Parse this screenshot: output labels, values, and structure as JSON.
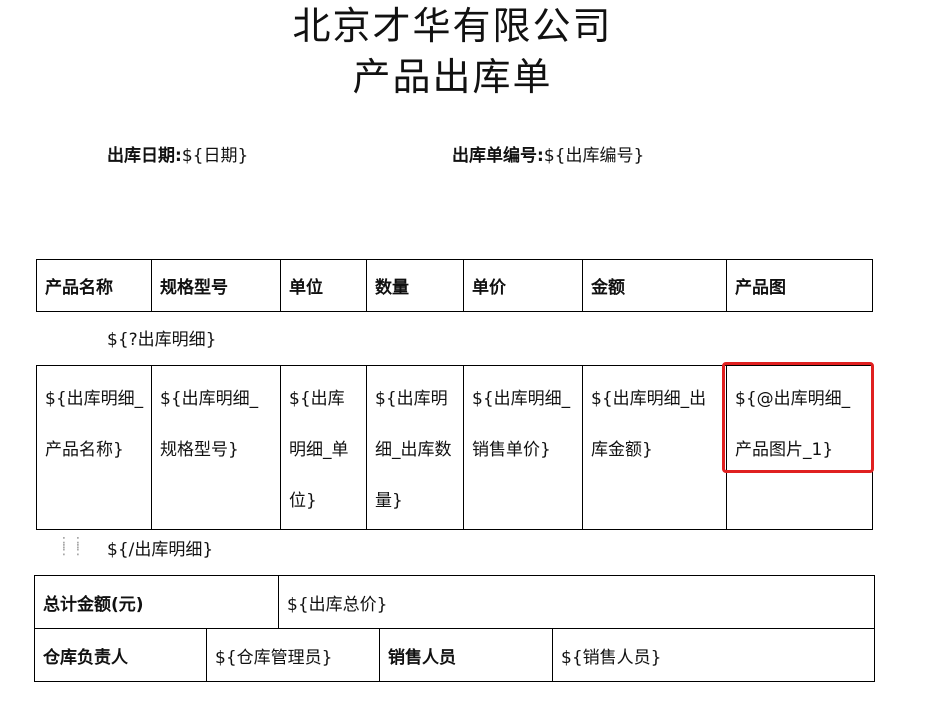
{
  "document": {
    "company": "北京才华有限公司",
    "title": "产品出库单"
  },
  "meta": {
    "date_label": "出库日期:",
    "date_value": "${日期}",
    "no_label": "出库单编号:",
    "no_value": "${出库编号}"
  },
  "table": {
    "headers": [
      "产品名称",
      "规格型号",
      "单位",
      "数量",
      "单价",
      "金额",
      "产品图"
    ],
    "loop_start": "${?出库明细}",
    "row": [
      "${出库明细_产品名称}",
      "${出库明细_规格型号}",
      "${出库明细_单位}",
      "${出库明细_出库数量}",
      "${出库明细_销售单价}",
      "${出库明细_出库金额}",
      "${@出库明细_产品图片_1}"
    ],
    "loop_end": "${/出库明细}"
  },
  "summary": {
    "total_label": "总计金额(元)",
    "total_value": "${出库总价}",
    "warehouse_label": "仓库负责人",
    "warehouse_value": "${仓库管理员}",
    "sales_label": "销售人员",
    "sales_value": "${销售人员}"
  },
  "colors": {
    "highlight": "#e02020",
    "border": "#000000"
  }
}
